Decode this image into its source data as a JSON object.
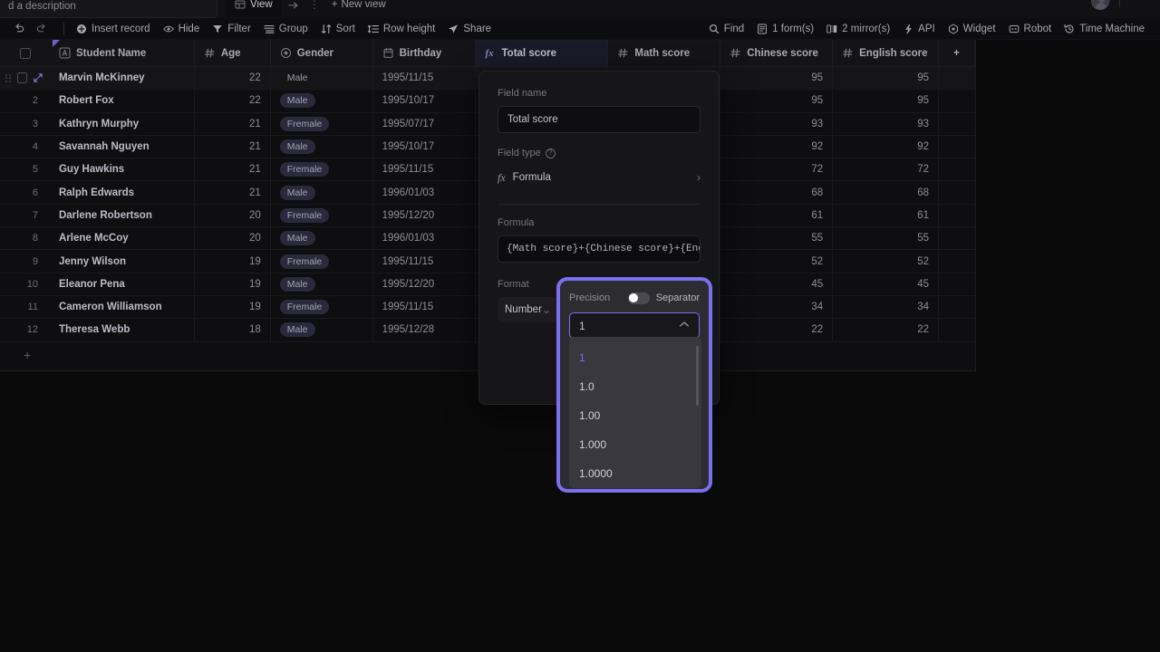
{
  "topbar": {
    "description_placeholder": "d a description",
    "view_tab": "View",
    "new_view": "New view",
    "icons": {
      "view": "grid-icon",
      "arrow": "arrow-right-icon",
      "more": "more-vertical-icon",
      "plus": "plus-icon"
    }
  },
  "toolbar": {
    "undo": "undo-icon",
    "redo": "redo-icon",
    "items": [
      {
        "label": "Insert record",
        "icon": "plus-circle-icon"
      },
      {
        "label": "Hide",
        "icon": "eye-icon"
      },
      {
        "label": "Filter",
        "icon": "funnel-icon"
      },
      {
        "label": "Group",
        "icon": "list-icon"
      },
      {
        "label": "Sort",
        "icon": "sort-icon"
      },
      {
        "label": "Row height",
        "icon": "row-height-icon"
      },
      {
        "label": "Share",
        "icon": "send-icon"
      }
    ],
    "right_items": [
      {
        "label": "Find",
        "icon": "search-icon"
      },
      {
        "label": "1 form(s)",
        "icon": "form-icon"
      },
      {
        "label": "2 mirror(s)",
        "icon": "mirror-icon"
      },
      {
        "label": "API",
        "icon": "api-icon"
      },
      {
        "label": "Widget",
        "icon": "widget-icon"
      },
      {
        "label": "Robot",
        "icon": "robot-icon"
      },
      {
        "label": "Time Machine",
        "icon": "history-icon"
      }
    ]
  },
  "grid": {
    "columns": [
      {
        "label": "Student Name",
        "type_icon": "text-field-icon"
      },
      {
        "label": "Age",
        "type_icon": "number-field-icon"
      },
      {
        "label": "Gender",
        "type_icon": "select-field-icon"
      },
      {
        "label": "Birthday",
        "type_icon": "date-field-icon"
      },
      {
        "label": "Total score",
        "type_icon": "formula-field-icon"
      },
      {
        "label": "Math score",
        "type_icon": "number-field-icon"
      },
      {
        "label": "Chinese score",
        "type_icon": "number-field-icon"
      },
      {
        "label": "English score",
        "type_icon": "number-field-icon"
      }
    ],
    "add_column": "+",
    "add_row": "+",
    "rows": [
      {
        "num": "1",
        "name": "Marvin McKinney",
        "age": "22",
        "gender": "Male",
        "birthday": "1995/11/15",
        "total": "",
        "math": "",
        "chinese": "95",
        "english": "95"
      },
      {
        "num": "2",
        "name": "Robert Fox",
        "age": "22",
        "gender": "Male",
        "birthday": "1995/10/17",
        "total": "",
        "math": "",
        "chinese": "95",
        "english": "95"
      },
      {
        "num": "3",
        "name": "Kathryn Murphy",
        "age": "21",
        "gender": "Fremale",
        "birthday": "1995/07/17",
        "total": "",
        "math": "",
        "chinese": "93",
        "english": "93"
      },
      {
        "num": "4",
        "name": "Savannah Nguyen",
        "age": "21",
        "gender": "Male",
        "birthday": "1995/10/17",
        "total": "",
        "math": "",
        "chinese": "92",
        "english": "92"
      },
      {
        "num": "5",
        "name": "Guy Hawkins",
        "age": "21",
        "gender": "Fremale",
        "birthday": "1995/11/15",
        "total": "",
        "math": "",
        "chinese": "72",
        "english": "72"
      },
      {
        "num": "6",
        "name": "Ralph Edwards",
        "age": "21",
        "gender": "Male",
        "birthday": "1996/01/03",
        "total": "",
        "math": "",
        "chinese": "68",
        "english": "68"
      },
      {
        "num": "7",
        "name": "Darlene Robertson",
        "age": "20",
        "gender": "Fremale",
        "birthday": "1995/12/20",
        "total": "",
        "math": "",
        "chinese": "61",
        "english": "61"
      },
      {
        "num": "8",
        "name": "Arlene McCoy",
        "age": "20",
        "gender": "Male",
        "birthday": "1996/01/03",
        "total": "",
        "math": "",
        "chinese": "55",
        "english": "55"
      },
      {
        "num": "9",
        "name": "Jenny Wilson",
        "age": "19",
        "gender": "Fremale",
        "birthday": "1995/11/15",
        "total": "",
        "math": "",
        "chinese": "52",
        "english": "52"
      },
      {
        "num": "10",
        "name": "Eleanor Pena",
        "age": "19",
        "gender": "Male",
        "birthday": "1995/12/20",
        "total": "",
        "math": "",
        "chinese": "45",
        "english": "45"
      },
      {
        "num": "11",
        "name": "Cameron Williamson",
        "age": "19",
        "gender": "Fremale",
        "birthday": "1995/11/15",
        "total": "",
        "math": "",
        "chinese": "34",
        "english": "34"
      },
      {
        "num": "12",
        "name": "Theresa Webb",
        "age": "18",
        "gender": "Male",
        "birthday": "1995/12/28",
        "total": "",
        "math": "",
        "chinese": "22",
        "english": "22"
      }
    ]
  },
  "panel": {
    "field_name_label": "Field name",
    "field_name_value": "Total score",
    "field_type_label": "Field type",
    "field_type_value": "Formula",
    "formula_label": "Formula",
    "formula_value": "{Math score}+{Chinese score}+{Eng",
    "format_label": "Format",
    "format_value": "Number"
  },
  "precision_popover": {
    "title": "Precision",
    "separator_label": "Separator",
    "separator_on": false,
    "selected_value": "1",
    "options": [
      "1",
      "1.0",
      "1.00",
      "1.000",
      "1.0000"
    ],
    "accent_color": "#7c6ef0"
  }
}
